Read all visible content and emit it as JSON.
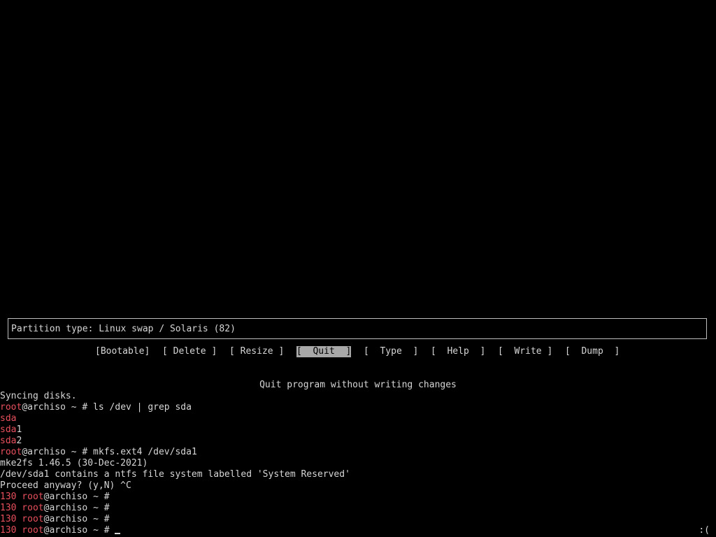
{
  "partition_type": "Partition type: Linux swap / Solaris (82)",
  "menu": [
    {
      "label": "[Bootable]",
      "selected": false
    },
    {
      "label": "[ Delete ]",
      "selected": false
    },
    {
      "label": "[ Resize ]",
      "selected": false
    },
    {
      "label": "[  Quit  ]",
      "selected": true
    },
    {
      "label": "[  Type  ]",
      "selected": false
    },
    {
      "label": "[  Help  ]",
      "selected": false
    },
    {
      "label": "[  Write ]",
      "selected": false
    },
    {
      "label": "[  Dump  ]",
      "selected": false
    }
  ],
  "status_message": "Quit program without writing changes",
  "terminal": [
    [
      {
        "t": "Syncing disks.",
        "c": "white"
      }
    ],
    [
      {
        "t": "root",
        "c": "red"
      },
      {
        "t": "@archiso ~ # ls /dev | grep sda",
        "c": "white"
      }
    ],
    [
      {
        "t": "sda",
        "c": "red"
      }
    ],
    [
      {
        "t": "sda",
        "c": "red"
      },
      {
        "t": "1",
        "c": "white"
      }
    ],
    [
      {
        "t": "sda",
        "c": "red"
      },
      {
        "t": "2",
        "c": "white"
      }
    ],
    [
      {
        "t": "root",
        "c": "red"
      },
      {
        "t": "@archiso ~ # mkfs.ext4 /dev/sda1",
        "c": "white"
      }
    ],
    [
      {
        "t": "mke2fs 1.46.5 (30-Dec-2021)",
        "c": "white"
      }
    ],
    [
      {
        "t": "/dev/sda1 contains a ntfs file system labelled 'System Reserved'",
        "c": "white"
      }
    ],
    [
      {
        "t": "Proceed anyway? (y,N) ^C",
        "c": "white"
      }
    ],
    [
      {
        "t": "130 root",
        "c": "red"
      },
      {
        "t": "@archiso ~ #",
        "c": "white"
      }
    ],
    [
      {
        "t": "130 root",
        "c": "red"
      },
      {
        "t": "@archiso ~ #",
        "c": "white"
      }
    ],
    [
      {
        "t": "130 root",
        "c": "red"
      },
      {
        "t": "@archiso ~ #",
        "c": "white"
      }
    ],
    [
      {
        "t": "130 root",
        "c": "red"
      },
      {
        "t": "@archiso ~ #",
        "c": "white"
      }
    ]
  ],
  "corner_text": ":(",
  "colors": {
    "background": "#000000",
    "text": "#d6d6d6",
    "prompt_red": "#e8505c",
    "selected_bg": "#a8a8a8"
  }
}
